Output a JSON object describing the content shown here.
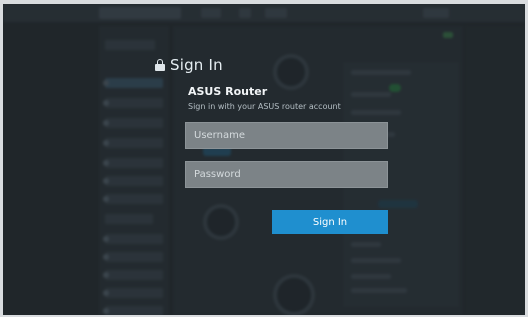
{
  "dialog": {
    "title": "Sign In",
    "device_name": "ASUS Router",
    "hint": "Sign in with your ASUS router account",
    "username_placeholder": "Username",
    "password_placeholder": "Password",
    "submit_label": "Sign In",
    "lock_icon": "lock-icon"
  },
  "colors": {
    "accent": "#1f8fcf",
    "overlay": "#2b3236",
    "status_green": "#2f7d45"
  }
}
